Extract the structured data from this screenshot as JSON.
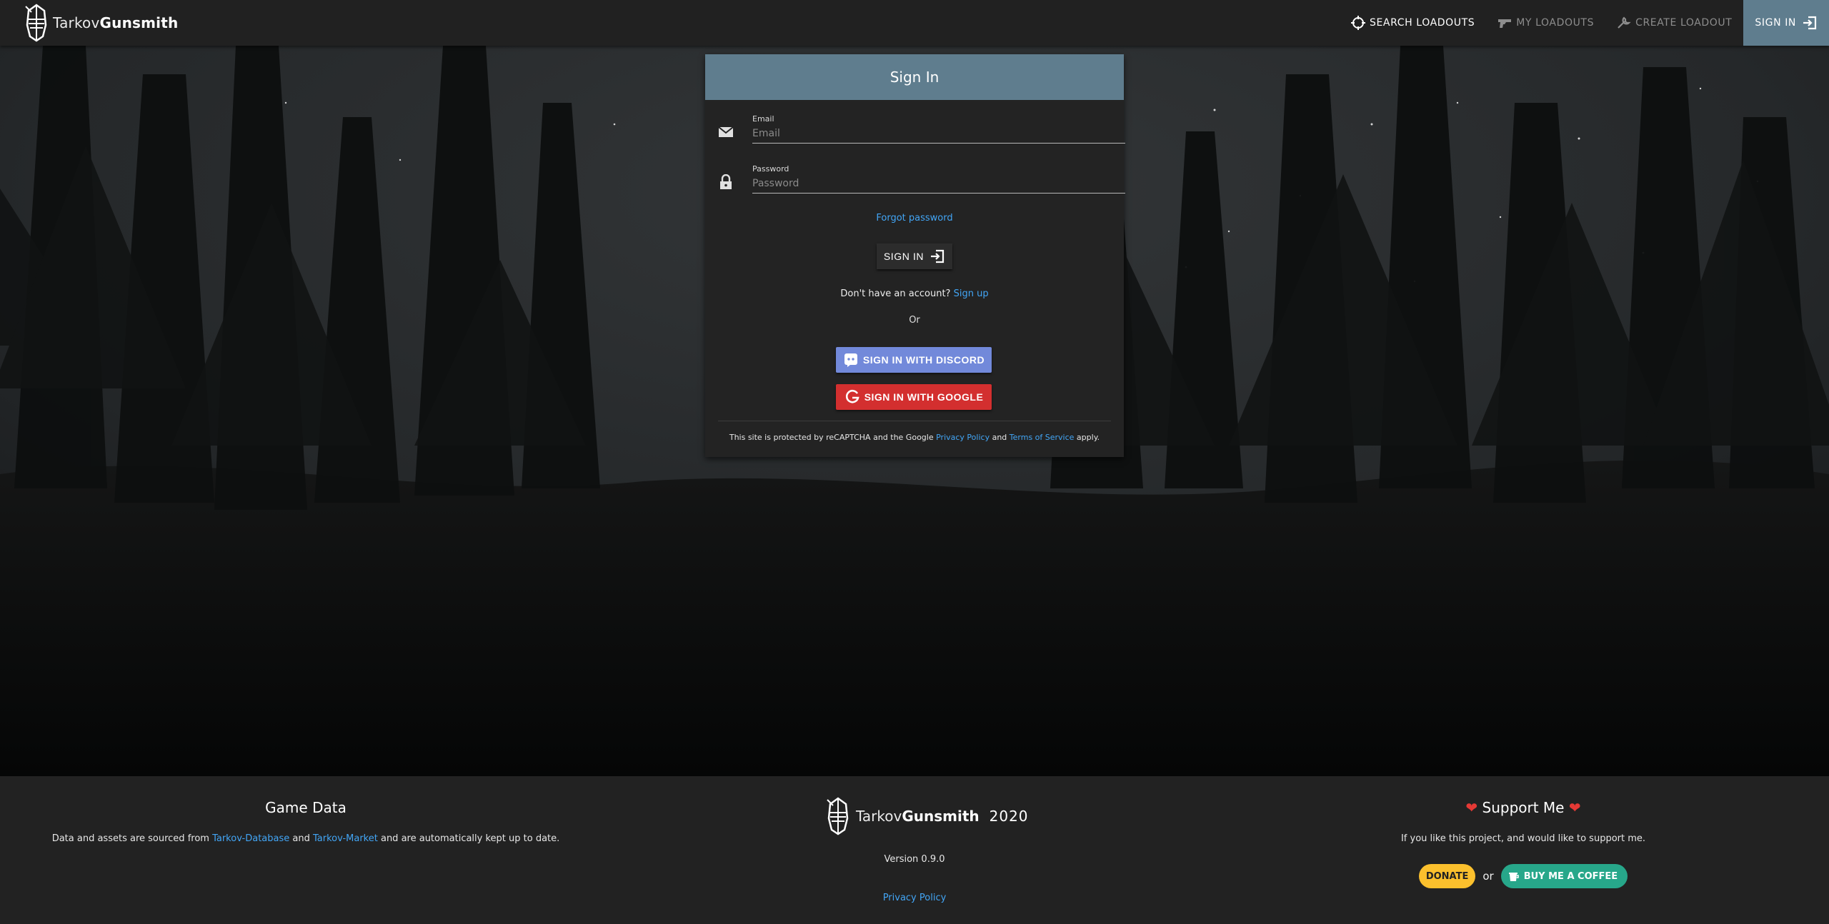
{
  "header": {
    "brand_light": "Tarkov",
    "brand_bold": "Gunsmith",
    "nav": {
      "search": "SEARCH LOADOUTS",
      "my": "MY LOADOUTS",
      "create": "CREATE LOADOUT",
      "signin": "SIGN IN"
    }
  },
  "signin_card": {
    "title": "Sign In",
    "email": {
      "label": "Email",
      "placeholder": "Email",
      "value": ""
    },
    "password": {
      "label": "Password",
      "placeholder": "Password",
      "value": ""
    },
    "forgot_password": "Forgot password",
    "signin_button": "SIGN IN",
    "no_account_text": "Don't have an account?",
    "signup_link": "Sign up",
    "or_text": "Or",
    "discord_button": "SIGN IN WITH DISCORD",
    "google_button": "SIGN IN WITH GOOGLE",
    "recaptcha": {
      "prefix": "This site is protected by reCAPTCHA and the Google ",
      "privacy_link": "Privacy Policy",
      "and": " and ",
      "terms_link": "Terms of Service",
      "suffix": " apply."
    }
  },
  "footer": {
    "game_data": {
      "title": "Game Data",
      "text_prefix": "Data and assets are sourced from ",
      "link1": "Tarkov-Database",
      "text_and": " and ",
      "link2": "Tarkov-Market",
      "text_suffix": " and are automatically kept up to date."
    },
    "center": {
      "brand_light": "Tarkov",
      "brand_bold": "Gunsmith",
      "year": "2020",
      "version": "Version 0.9.0",
      "privacy_link": "Privacy Policy"
    },
    "support": {
      "title": "Support Me",
      "text": "If you like this project, and would like to support me.",
      "donate": "DONATE",
      "or": "or",
      "coffee": "BUY ME A COFFEE"
    }
  },
  "colors": {
    "accent": "#5f7d8e",
    "link": "#42a5f5",
    "discord": "#7289da",
    "google": "#d32f2f",
    "donate": "#fbc02d",
    "coffee": "#27a78a"
  },
  "icons": [
    "knight-helmet-logo-icon",
    "crosshair-icon",
    "gun-icon",
    "wrench-icon",
    "sign-in-icon",
    "email-icon",
    "lock-icon",
    "discord-icon",
    "google-icon",
    "heart-icon",
    "coffee-icon"
  ]
}
